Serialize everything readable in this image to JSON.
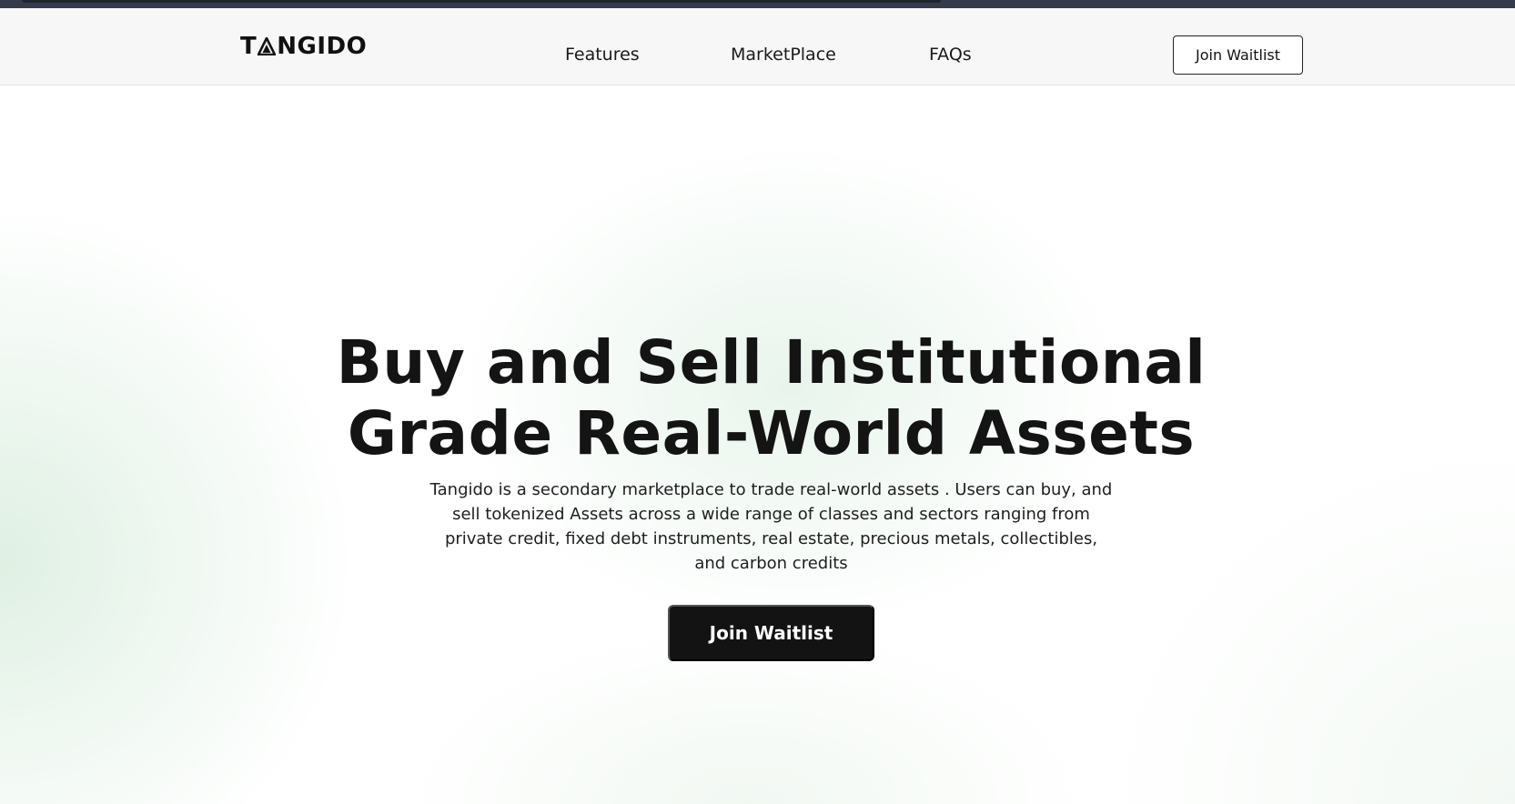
{
  "header": {
    "logo_text": "TANGIDO",
    "nav": {
      "features": "Features",
      "marketplace": "MarketPlace",
      "faqs": "FAQs"
    },
    "cta_label": "Join Waitlist"
  },
  "hero": {
    "title_line1": "Buy and Sell Institutional",
    "title_line2": "Grade Real-World Assets",
    "description": "Tangido is a secondary marketplace to trade real-world assets . Users can buy, and sell tokenized Assets across a wide range of classes and sectors ranging from private credit, fixed debt instruments, real estate, precious metals, collectibles, and carbon credits",
    "cta_label": "Join Waitlist"
  },
  "colors": {
    "navbar_bg": "#f7f7f7",
    "text": "#141414",
    "cta_bg": "#131313",
    "hero_tint": "#d6ecdc"
  }
}
